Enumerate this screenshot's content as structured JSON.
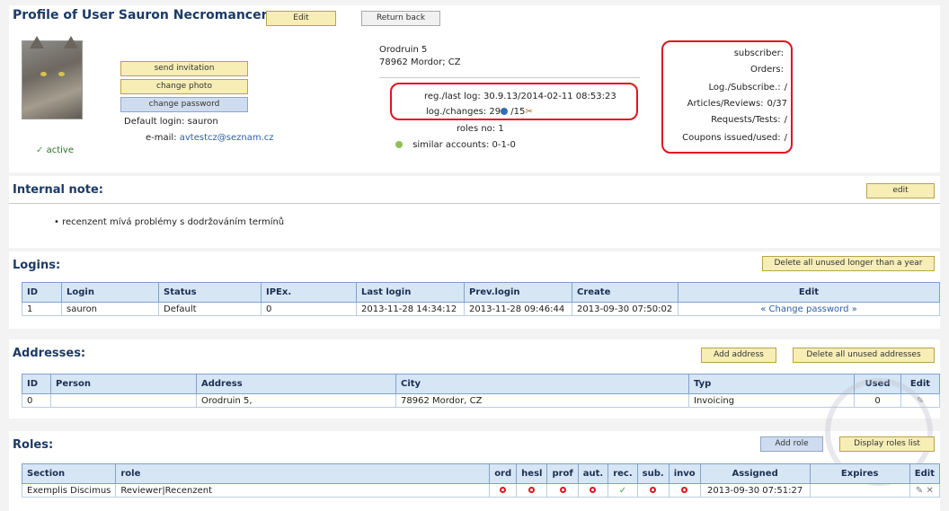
{
  "profile": {
    "title": "Profile of User Sauron Necromancer",
    "edit_label": "Edit",
    "return_label": "Return back",
    "status": "active",
    "send_invitation": "send invitation",
    "change_photo": "change photo",
    "change_password": "change password",
    "default_login_label": "Default login:",
    "default_login_value": "sauron",
    "email_label": "e-mail:",
    "email_value": "avtestcz@seznam.cz",
    "address_line1": "Orodruin 5",
    "address_line2": "78962 Mordor; CZ",
    "reg_label": "reg./last log:",
    "reg_value": "30.9.13/2014-02-11 08:53:23",
    "log_changes_label": "log./changes:",
    "log_changes_a": "29",
    "log_changes_b": "/15",
    "roles_no_label": "roles no:",
    "roles_no_value": "1",
    "similar_label": "similar accounts:",
    "similar_value": "0-1-0",
    "stats": [
      {
        "label": "subscriber:",
        "value": ""
      },
      {
        "label": "Orders:",
        "value": ""
      },
      {
        "label": "Log./Subscribe.:",
        "value": "/"
      },
      {
        "label": "Articles/Reviews:",
        "value": "0/37"
      },
      {
        "label": "Requests/Tests:",
        "value": "/"
      },
      {
        "label": "Coupons issued/used:",
        "value": "/"
      }
    ]
  },
  "internal_note": {
    "title": "Internal note:",
    "edit_label": "edit",
    "items": [
      "recenzent mívá problémy s dodržováním termínů"
    ]
  },
  "logins": {
    "title": "Logins:",
    "delete_label": "Delete all unused longer than a year",
    "columns": [
      "ID",
      "Login",
      "Status",
      "IPEx.",
      "Last login",
      "Prev.login",
      "Create",
      "Edit"
    ],
    "rows": [
      [
        "1",
        "sauron",
        "Default",
        "0",
        "2013-11-28 14:34:12",
        "2013-11-28 09:46:44",
        "2013-09-30 07:50:02",
        "« Change password »"
      ]
    ]
  },
  "addresses": {
    "title": "Addresses:",
    "add_label": "Add address",
    "delete_label": "Delete all unused addresses",
    "columns": [
      "ID",
      "Person",
      "Address",
      "City",
      "Typ",
      "Used",
      "Edit"
    ],
    "rows": [
      [
        "0",
        "",
        "Orodruin 5,",
        "78962 Mordor, CZ",
        "Invoicing",
        "0"
      ]
    ]
  },
  "roles": {
    "title": "Roles:",
    "add_label": "Add role",
    "display_label": "Display roles list",
    "columns": [
      "Section",
      "role",
      "ord",
      "hesl",
      "prof",
      "aut.",
      "rec.",
      "sub.",
      "invo",
      "Assigned",
      "Expires",
      "Edit"
    ],
    "rows": [
      [
        "Exemplis Discimus",
        "Reviewer|Recenzent",
        "",
        "",
        "",
        "",
        "",
        "",
        "",
        "2013-09-30 07:51:27",
        ""
      ]
    ]
  },
  "colors": {
    "heading": "#1c3a66",
    "button_yellow": "#f6eeb5",
    "button_blue": "#cfdcf0",
    "table_header": "#d7e6f5",
    "highlight_red": "#e0141e",
    "check_green": "#3aa844"
  }
}
